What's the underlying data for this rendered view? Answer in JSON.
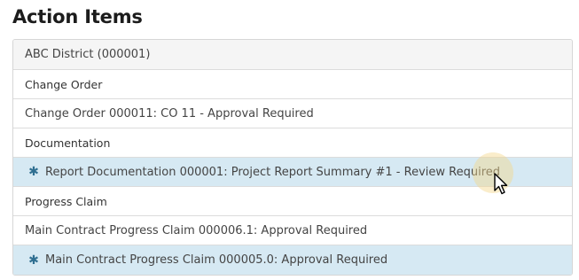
{
  "title": "Action Items",
  "panel": {
    "header": "ABC District (000001)",
    "groups": [
      {
        "category": "Change Order",
        "items": [
          {
            "label": "Change Order 000011: CO 11 - Approval Required",
            "unread": false
          }
        ]
      },
      {
        "category": "Documentation",
        "items": [
          {
            "label": "Report Documentation 000001: Project Report Summary #1 - Review Required",
            "unread": true
          }
        ]
      },
      {
        "category": "Progress Claim",
        "items": [
          {
            "label": "Main Contract Progress Claim 000006.1: Approval Required",
            "unread": false
          },
          {
            "label": "Main Contract Progress Claim 000005.0: Approval Required",
            "unread": true
          }
        ]
      }
    ]
  },
  "icons": {
    "unread_marker": "asterisk-icon",
    "cursor": "mouse-pointer-icon"
  },
  "colors": {
    "unread_bg": "#d6e9f3",
    "header_bg": "#f5f5f5",
    "marker": "#2f6f91"
  }
}
